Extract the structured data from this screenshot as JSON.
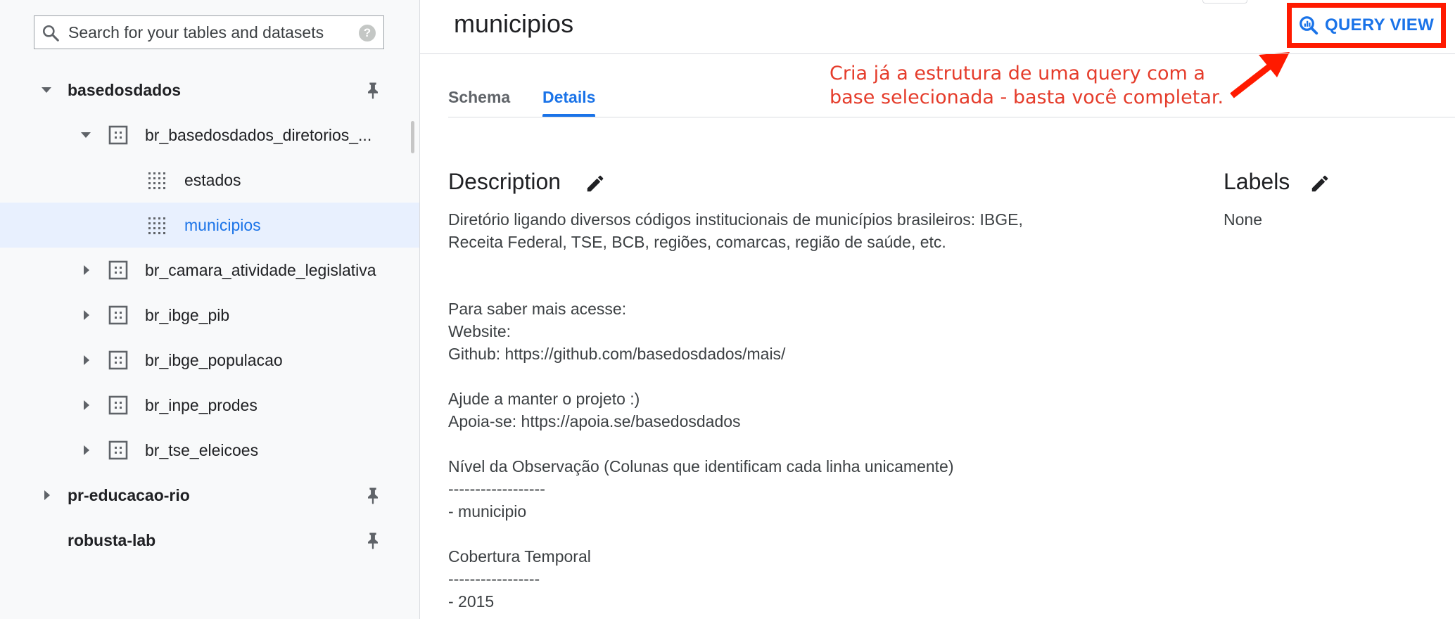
{
  "sidebar": {
    "search": {
      "placeholder": "Search for your tables and datasets",
      "value": ""
    },
    "help_glyph": "?",
    "tree": {
      "projects": [
        {
          "name": "basedosdados",
          "expanded": true,
          "datasets": [
            {
              "name": "br_basedosdados_diretorios_...",
              "expanded": true,
              "tables": [
                {
                  "name": "estados",
                  "selected": false
                },
                {
                  "name": "municipios",
                  "selected": true
                }
              ]
            },
            {
              "name": "br_camara_atividade_legislativa",
              "expanded": false
            },
            {
              "name": "br_ibge_pib",
              "expanded": false
            },
            {
              "name": "br_ibge_populacao",
              "expanded": false
            },
            {
              "name": "br_inpe_prodes",
              "expanded": false
            },
            {
              "name": "br_tse_eleicoes",
              "expanded": false
            }
          ]
        },
        {
          "name": "pr-educacao-rio",
          "expanded": false
        },
        {
          "name": "robusta-lab"
        }
      ]
    }
  },
  "main": {
    "title": "municipios",
    "query_view_label": "QUERY VIEW",
    "annotation": {
      "line1": "Cria já a estrutura de uma query com a",
      "line2": "base selecionada - basta você completar."
    },
    "tabs": [
      {
        "label": "Schema",
        "active": false
      },
      {
        "label": "Details",
        "active": true
      }
    ],
    "description": {
      "heading": "Description",
      "lines": [
        "Diretório ligando diversos códigos institucionais de municípios brasileiros: IBGE,",
        "Receita Federal, TSE, BCB, regiões, comarcas, região de saúde, etc.",
        "Para saber mais acesse:",
        "Website:",
        "Github: https://github.com/basedosdados/mais/",
        "Ajude a manter o projeto :)",
        "Apoia-se: https://apoia.se/basedosdados",
        "Nível da Observação (Colunas que identificam cada linha unicamente)",
        "------------------",
        "- municipio",
        "Cobertura Temporal",
        "-----------------",
        "- 2015"
      ]
    },
    "labels": {
      "heading": "Labels",
      "value": "None"
    }
  },
  "colors": {
    "accent": "#1a73e8",
    "annotation_red": "#e53c2b",
    "highlight_border": "#ff1a00",
    "selected_row_bg": "#e8f0fe"
  }
}
